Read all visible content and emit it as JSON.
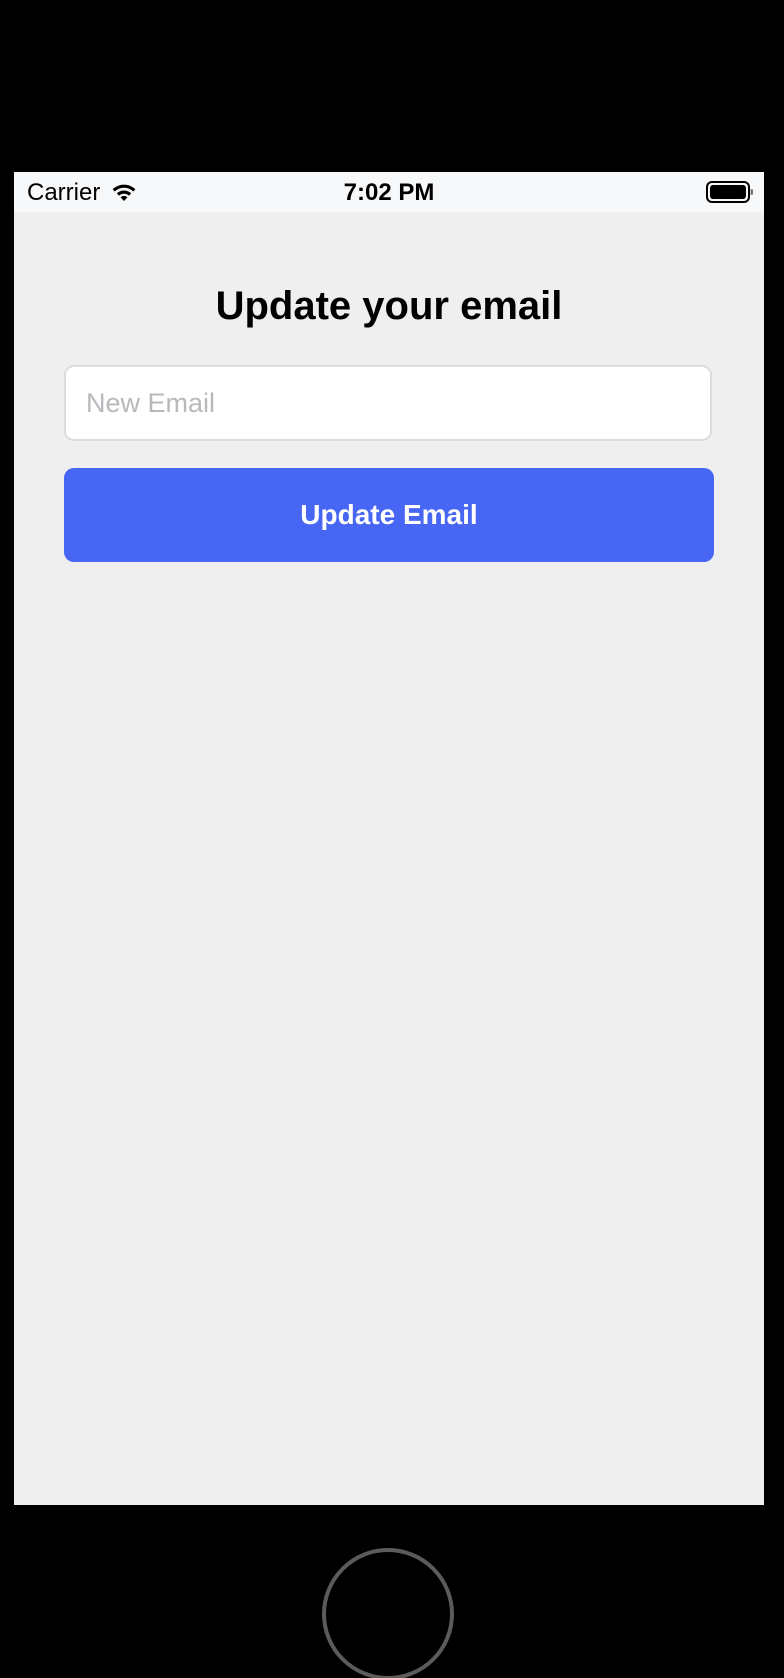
{
  "status_bar": {
    "carrier": "Carrier",
    "time": "7:02 PM",
    "wifi_icon": "wifi-icon",
    "battery_icon": "battery-icon"
  },
  "screen": {
    "title": "Update your email",
    "email_input": {
      "placeholder": "New Email",
      "value": ""
    },
    "update_button": {
      "label": "Update Email"
    }
  },
  "colors": {
    "background": "#efefef",
    "status_bar": "#f7f8f9",
    "accent": "#4666f3",
    "placeholder": "#b8b8bd"
  }
}
